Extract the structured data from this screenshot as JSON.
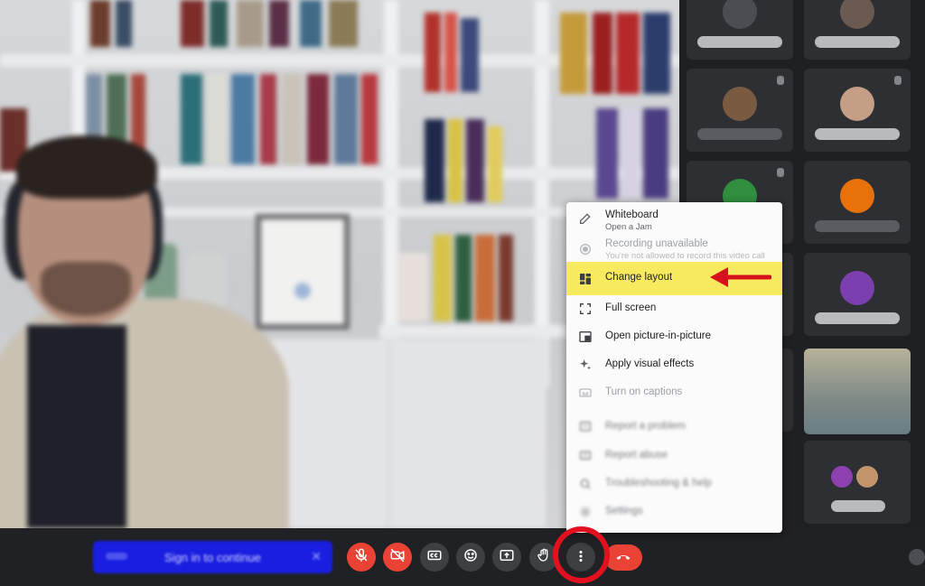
{
  "menu": {
    "items": [
      {
        "label": "Whiteboard",
        "sublabel": "Open a Jam",
        "icon": "pencil-icon",
        "state": "normal"
      },
      {
        "label": "Recording unavailable",
        "sublabel": "You're not allowed to record this video call",
        "icon": "record-icon",
        "state": "disabled"
      },
      {
        "label": "Change layout",
        "sublabel": "",
        "icon": "layout-icon",
        "state": "highlighted"
      },
      {
        "label": "Full screen",
        "sublabel": "",
        "icon": "fullscreen-icon",
        "state": "normal"
      },
      {
        "label": "Open picture-in-picture",
        "sublabel": "",
        "icon": "pip-icon",
        "state": "normal"
      },
      {
        "label": "Apply visual effects",
        "sublabel": "",
        "icon": "sparkle-icon",
        "state": "normal"
      },
      {
        "label": "Turn on captions",
        "sublabel": "",
        "icon": "captions-icon",
        "state": "disabled"
      },
      {
        "label": "Report a problem",
        "sublabel": "",
        "icon": "report-icon",
        "state": "blurred"
      },
      {
        "label": "Report abuse",
        "sublabel": "",
        "icon": "abuse-icon",
        "state": "blurred"
      },
      {
        "label": "Troubleshooting & help",
        "sublabel": "",
        "icon": "help-icon",
        "state": "blurred"
      },
      {
        "label": "Settings",
        "sublabel": "",
        "icon": "gear-icon",
        "state": "blurred"
      }
    ]
  },
  "controls": {
    "sign_in_label": "Sign in to continue",
    "buttons": [
      {
        "name": "mic-off-button",
        "icon": "mic-off-icon",
        "color": "#ea4335"
      },
      {
        "name": "camera-off-button",
        "icon": "camera-off-icon",
        "color": "#ea4335"
      },
      {
        "name": "captions-button",
        "icon": "cc-icon",
        "color": "#3c4043"
      },
      {
        "name": "emoji-button",
        "icon": "smiley-icon",
        "color": "#3c4043"
      },
      {
        "name": "present-button",
        "icon": "present-icon",
        "color": "#3c4043"
      },
      {
        "name": "raise-hand-button",
        "icon": "hand-icon",
        "color": "#3c4043"
      },
      {
        "name": "more-options-button",
        "icon": "dots-vertical-icon",
        "color": "#3c4043"
      },
      {
        "name": "end-call-button",
        "icon": "hangup-icon",
        "color": "#ea4335"
      }
    ]
  },
  "colors": {
    "highlight": "#f7ea5f",
    "annotation_red": "#e3101f",
    "danger": "#ea4335",
    "bar_background": "#202124"
  }
}
